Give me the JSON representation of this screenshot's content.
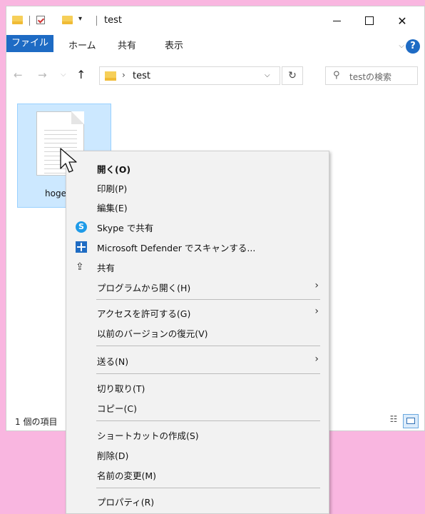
{
  "window": {
    "title": "test",
    "controls": {
      "minimize": "—",
      "maximize": "□",
      "close": "✕"
    }
  },
  "ribbon": {
    "tabs": [
      "ファイル",
      "ホーム",
      "共有",
      "表示"
    ],
    "help": "?"
  },
  "navigation": {
    "back": "←",
    "forward": "→",
    "recent": "⌵",
    "up": "↑",
    "address_separator": "›",
    "address_path": "test",
    "address_dropdown": "⌵",
    "refresh": "↻",
    "search_icon": "⚲",
    "search_placeholder": "testの検索"
  },
  "content": {
    "file_name_visible": "hoge",
    "selected": true
  },
  "statusbar": {
    "item_count": "1 個の項目",
    "view_details_icon": "☷"
  },
  "context_menu": {
    "arrow": "›",
    "items": [
      {
        "label": "開く(O)",
        "bold": true
      },
      {
        "label": "印刷(P)"
      },
      {
        "label": "編集(E)"
      },
      {
        "label": "Skype で共有",
        "icon": "skype-icon",
        "icon_text": "S"
      },
      {
        "label": "Microsoft Defender でスキャンする...",
        "icon": "defender-icon"
      },
      {
        "label": "共有",
        "icon": "share-icon",
        "icon_text": "⇪"
      },
      {
        "label": "プログラムから開く(H)",
        "submenu": true
      },
      {
        "label": "アクセスを許可する(G)",
        "submenu": true
      },
      {
        "label": "以前のバージョンの復元(V)"
      },
      {
        "label": "送る(N)",
        "submenu": true
      },
      {
        "label": "切り取り(T)"
      },
      {
        "label": "コピー(C)"
      },
      {
        "label": "ショートカットの作成(S)"
      },
      {
        "label": "削除(D)"
      },
      {
        "label": "名前の変更(M)"
      },
      {
        "label": "プロパティ(R)"
      }
    ]
  },
  "colors": {
    "desktop": "#f9b6e0",
    "accent": "#1e6bc4",
    "selection": "#cce8ff",
    "menu_bg": "#f2f2f2"
  }
}
